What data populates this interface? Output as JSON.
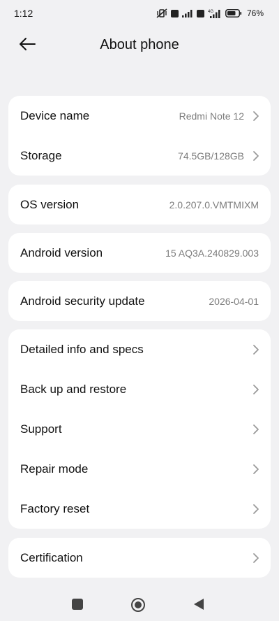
{
  "status_bar": {
    "time": "1:12",
    "battery": "76",
    "icons": [
      "vibrate-off-icon",
      "volte-badge-icon",
      "signal-icon",
      "volte-badge-icon",
      "4g-signal-icon",
      "battery-icon"
    ]
  },
  "header": {
    "title": "About phone",
    "back_icon": "arrow-left-icon"
  },
  "cards": {
    "device": {
      "device_name_label": "Device name",
      "device_name_value": "Redmi Note 12",
      "storage_label": "Storage",
      "storage_value": "74.5GB/128GB"
    },
    "os": {
      "label": "OS version",
      "value": "2.0.207.0.VMTMIXM"
    },
    "android": {
      "label": "Android version",
      "value": "15 AQ3A.240829.003"
    },
    "security": {
      "label": "Android security update",
      "value": "2026-04-01"
    },
    "more": {
      "items": [
        "Detailed info and specs",
        "Back up and restore",
        "Support",
        "Repair mode",
        "Factory reset"
      ]
    },
    "certification": {
      "label": "Certification"
    }
  },
  "nav_bar": {
    "icons": [
      "recents-square-icon",
      "home-circle-icon",
      "back-triangle-icon"
    ]
  },
  "colors": {
    "background": "#f1f1f3",
    "card": "#ffffff",
    "secondary_text": "#7d7d7d"
  }
}
